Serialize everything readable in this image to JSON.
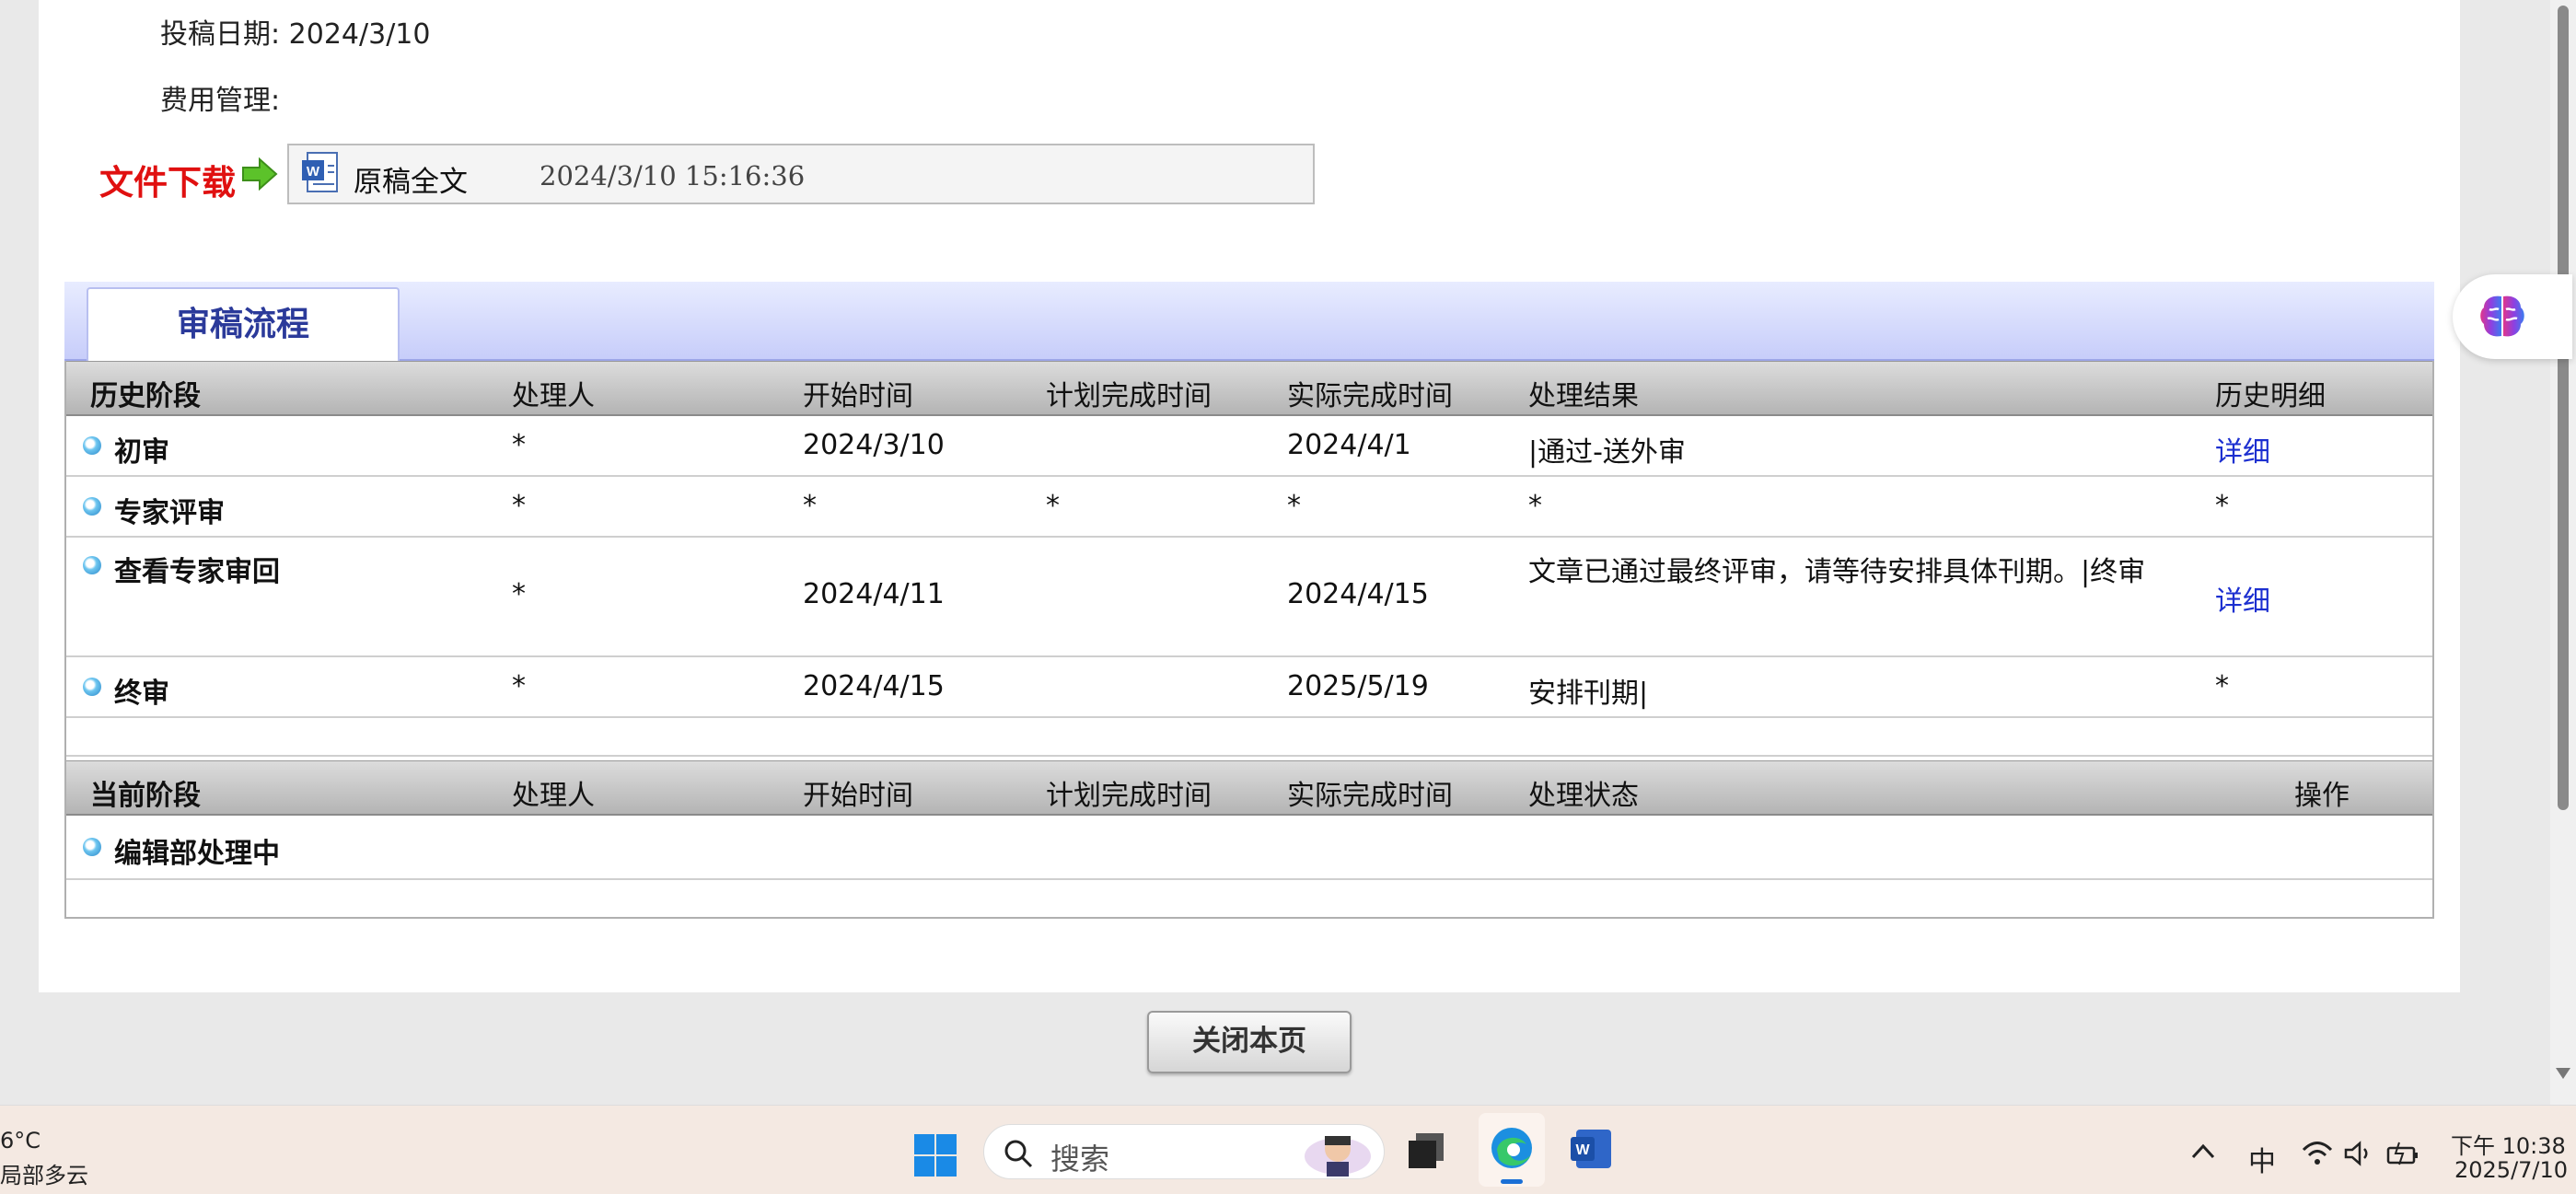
{
  "info": {
    "submit_date_label": "投稿日期:",
    "submit_date_value": "2024/3/10",
    "fee_label": "费用管理:"
  },
  "download": {
    "label": "文件下载",
    "file_name": "原稿全文",
    "file_time": "2024/3/10 15:16:36"
  },
  "review_tab": "审稿流程",
  "history": {
    "headers": [
      "历史阶段",
      "处理人",
      "开始时间",
      "计划完成时间",
      "实际完成时间",
      "处理结果",
      "历史明细"
    ],
    "rows": [
      {
        "stage": "初审",
        "handler": "*",
        "start": "2024/3/10",
        "plan": "",
        "actual": "2024/4/1",
        "result": "|通过-送外审",
        "detail": "详细"
      },
      {
        "stage": "专家评审",
        "handler": "*",
        "start": "*",
        "plan": "*",
        "actual": "*",
        "result": "*",
        "detail": "*"
      },
      {
        "stage": "查看专家审回",
        "handler": "*",
        "start": "2024/4/11",
        "plan": "",
        "actual": "2024/4/15",
        "result": "文章已通过最终评审，请等待安排具体刊期。|终审",
        "detail": "详细"
      },
      {
        "stage": "终审",
        "handler": "*",
        "start": "2024/4/15",
        "plan": "",
        "actual": "2025/5/19",
        "result": "安排刊期|",
        "detail": "*"
      }
    ]
  },
  "current": {
    "headers": [
      "当前阶段",
      "处理人",
      "开始时间",
      "计划完成时间",
      "实际完成时间",
      "处理状态",
      "操作"
    ],
    "rows": [
      {
        "stage": "编辑部处理中"
      }
    ]
  },
  "close_button": "关闭本页",
  "taskbar": {
    "weather_temp": "6°C",
    "weather_desc": "局部多云",
    "search_placeholder": "搜索",
    "ime": "中",
    "time": "下午 10:38",
    "date": "2025/7/10"
  }
}
